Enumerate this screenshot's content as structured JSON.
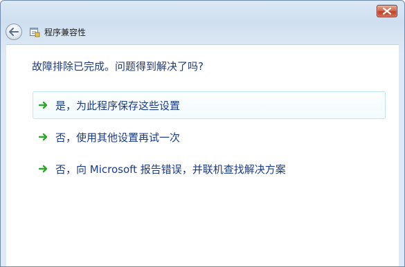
{
  "window": {
    "title": "程序兼容性",
    "title_icon": "compatibility-icon",
    "close_icon": "close-icon",
    "back_icon": "back-arrow-icon"
  },
  "content": {
    "question": "故障排除已完成。问题得到解决了吗?",
    "options": [
      {
        "label": "是，为此程序保存这些设置",
        "icon": "green-arrow-icon",
        "highlighted": true
      },
      {
        "label": "否，使用其他设置再试一次",
        "icon": "green-arrow-icon",
        "highlighted": false
      },
      {
        "label": "否，向 Microsoft 报告错误，并联机查找解决方案",
        "icon": "green-arrow-icon",
        "highlighted": false
      }
    ]
  },
  "colors": {
    "link_text": "#1a3a86",
    "question_text": "#1f3a7a",
    "arrow": "#2fa52a",
    "close_button": "#c1402a",
    "hover_border": "#bfe6f2"
  }
}
